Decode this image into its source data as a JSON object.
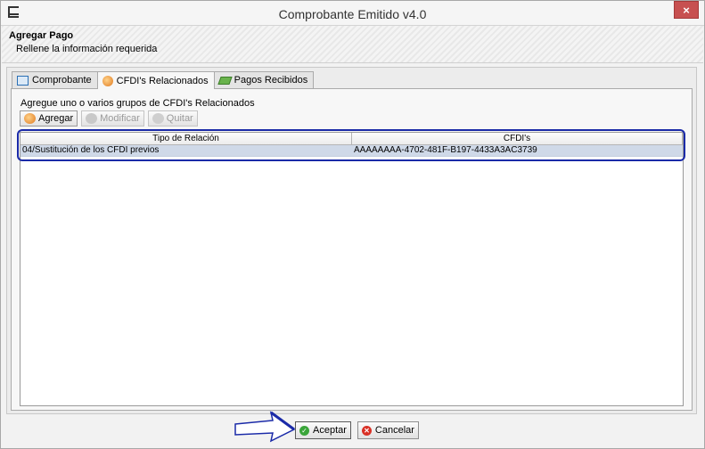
{
  "window": {
    "title": "Comprobante Emitido v4.0",
    "close_label": "×"
  },
  "header": {
    "title": "Agregar Pago",
    "subtitle": "Rellene la información requerida"
  },
  "tabs": [
    {
      "label": "Comprobante",
      "icon": "document-icon"
    },
    {
      "label": "CFDI's Relacionados",
      "icon": "cfdi-icon",
      "active": true
    },
    {
      "label": "Pagos Recibidos",
      "icon": "money-icon"
    }
  ],
  "content": {
    "instruction": "Agregue uno o varios grupos de CFDI's Relacionados",
    "toolbar": {
      "add_label": "Agregar",
      "modify_label": "Modificar",
      "remove_label": "Quitar"
    },
    "table": {
      "columns": [
        "Tipo de Relación",
        "CFDI's"
      ],
      "rows": [
        [
          "04/Sustitución de los CFDI previos",
          "AAAAAAAA-4702-481F-B197-4433A3AC3739"
        ]
      ]
    }
  },
  "footer": {
    "accept_label": "Aceptar",
    "cancel_label": "Cancelar"
  },
  "colors": {
    "highlight": "#1a2aa8",
    "selected_row": "#cfd9e8",
    "close_button": "#c75050"
  }
}
